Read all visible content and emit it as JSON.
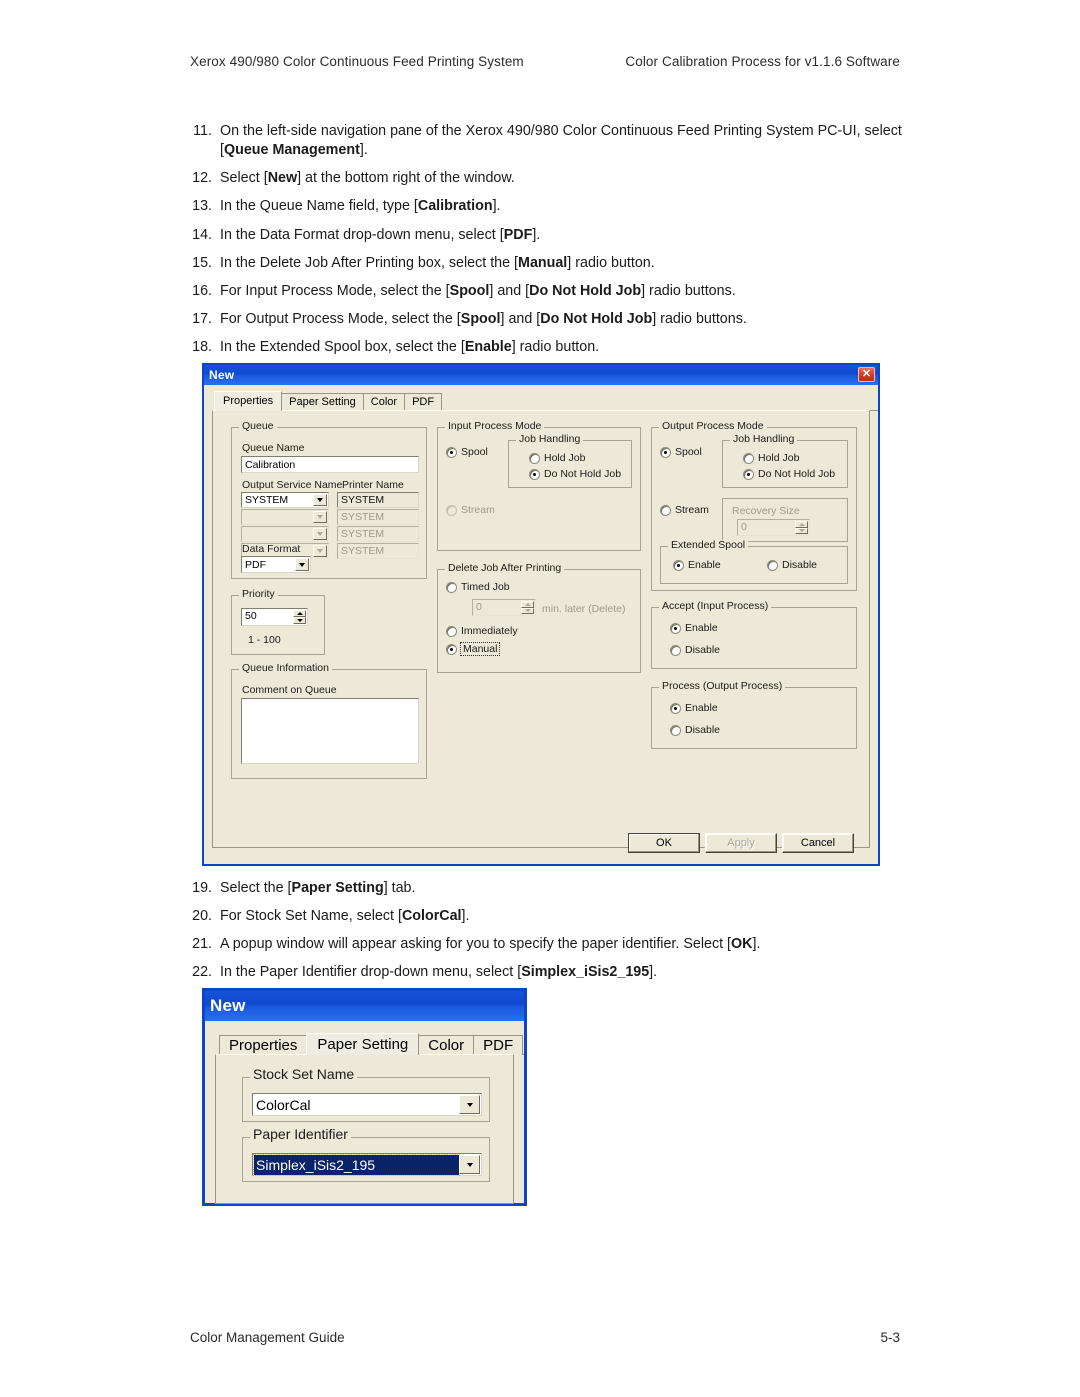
{
  "header": {
    "left": "Xerox 490/980 Color Continuous Feed Printing System",
    "right": "Color Calibration Process for v1.1.6 Software"
  },
  "footer": {
    "left": "Color Management Guide",
    "right": "5-3"
  },
  "steps_top": [
    {
      "num": "11.",
      "html": "On the left-side navigation pane of the Xerox 490/980 Color Continuous Feed Printing System PC-UI, select [<b>Queue Management</b>]."
    },
    {
      "num": "12.",
      "html": "Select [<b>New</b>] at the bottom right of the window."
    },
    {
      "num": "13.",
      "html": "In the Queue Name field, type [<b>Calibration</b>]."
    },
    {
      "num": "14.",
      "html": "In the Data Format drop-down menu, select [<b>PDF</b>]."
    },
    {
      "num": "15.",
      "html": "In the Delete Job After Printing box, select the [<b>Manual</b>] radio button."
    },
    {
      "num": "16.",
      "html": "For Input Process Mode, select the [<b>Spool</b>] and [<b>Do Not Hold Job</b>] radio buttons."
    },
    {
      "num": "17.",
      "html": "For Output Process Mode, select the [<b>Spool</b>] and [<b>Do Not Hold Job</b>] radio buttons."
    },
    {
      "num": "18.",
      "html": "In the Extended Spool box, select the [<b>Enable</b>] radio button."
    }
  ],
  "steps_bottom": [
    {
      "num": "19.",
      "html": "Select the [<b>Paper Setting</b>] tab."
    },
    {
      "num": "20.",
      "html": "For Stock Set Name, select [<b>ColorCal</b>]."
    },
    {
      "num": "21.",
      "html": "A popup window will appear asking for you to specify the paper identifier. Select [<b>OK</b>]."
    },
    {
      "num": "22.",
      "html": "In the Paper Identifier drop-down menu, select [<b>Simplex_iSis2_195</b>]."
    }
  ],
  "dialog1": {
    "title": "New",
    "close_label": "✕",
    "tabs": [
      {
        "label": "Properties",
        "active": true
      },
      {
        "label": "Paper Setting",
        "active": false
      },
      {
        "label": "Color",
        "active": false
      },
      {
        "label": "PDF",
        "active": false
      }
    ],
    "queue": {
      "group_label": "Queue",
      "queue_name_label": "Queue Name",
      "queue_name_value": "Calibration",
      "output_service_label": "Output Service Name",
      "printer_name_label": "Printer Name",
      "service_rows": [
        {
          "service": "SYSTEM",
          "printer": "SYSTEM",
          "enabled": true
        },
        {
          "service": "",
          "printer": "SYSTEM",
          "enabled": false
        },
        {
          "service": "",
          "printer": "SYSTEM",
          "enabled": false
        },
        {
          "service": "",
          "printer": "SYSTEM",
          "enabled": false
        }
      ],
      "data_format_label": "Data Format",
      "data_format_value": "PDF"
    },
    "priority": {
      "group_label": "Priority",
      "value": "50",
      "range": "1 - 100"
    },
    "queue_information": {
      "group_label": "Queue Information",
      "comment_label": "Comment on Queue",
      "comment_value": ""
    },
    "input_process_mode": {
      "group_label": "Input Process Mode",
      "spool": "Spool",
      "stream": "Stream",
      "job_handling_label": "Job Handling",
      "hold_job": "Hold Job",
      "do_not_hold_job": "Do Not Hold Job"
    },
    "delete_job": {
      "group_label": "Delete Job After Printing",
      "timed_job": "Timed Job",
      "minutes_value": "0",
      "minutes_suffix": "min. later (Delete)",
      "immediately": "Immediately",
      "manual": "Manual"
    },
    "output_process_mode": {
      "group_label": "Output Process Mode",
      "spool": "Spool",
      "stream": "Stream",
      "job_handling_label": "Job Handling",
      "hold_job": "Hold Job",
      "do_not_hold_job": "Do Not Hold Job",
      "recovery_size_label": "Recovery Size",
      "recovery_size_value": "0"
    },
    "extended_spool": {
      "group_label": "Extended Spool",
      "enable": "Enable",
      "disable": "Disable"
    },
    "accept_input_process": {
      "group_label": "Accept (Input Process)",
      "enable": "Enable",
      "disable": "Disable"
    },
    "process_output_process": {
      "group_label": "Process (Output Process)",
      "enable": "Enable",
      "disable": "Disable"
    },
    "buttons": {
      "ok": "OK",
      "apply": "Apply",
      "cancel": "Cancel"
    }
  },
  "dialog2": {
    "title": "New",
    "tabs": [
      {
        "label": "Properties",
        "active": false
      },
      {
        "label": "Paper Setting",
        "active": true
      },
      {
        "label": "Color",
        "active": false
      },
      {
        "label": "PDF",
        "active": false
      }
    ],
    "stock_set": {
      "group_label": "Stock Set Name",
      "value": "ColorCal"
    },
    "paper_identifier": {
      "group_label": "Paper Identifier",
      "value": "Simplex_iSis2_195"
    }
  },
  "colors": {
    "titlebar_blue": "#0f49cf",
    "dialog_face": "#ece9d8",
    "selection_blue": "#0a246a",
    "close_red": "#d8402a"
  }
}
